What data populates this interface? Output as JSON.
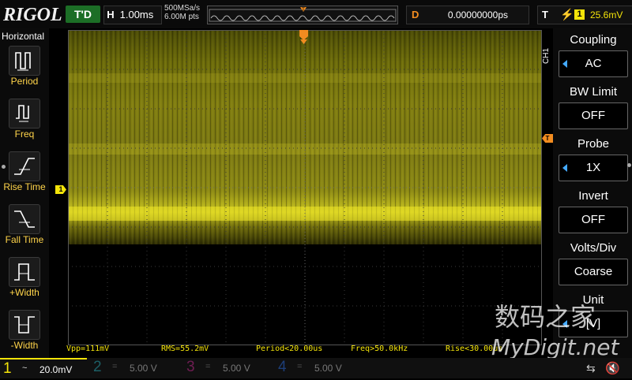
{
  "brand": "RIGOL",
  "header": {
    "trigger_status": "T'D",
    "timebase_label": "H",
    "timebase_value": "1.00ms",
    "sample_rate": "500MSa/s",
    "memory_depth": "6.00M pts",
    "delay_label": "D",
    "delay_value": "0.00000000ps",
    "trigger_label": "T",
    "trigger_source": "1",
    "trigger_level": "25.6mV",
    "trigger_edge_icon": "rising-edge-icon"
  },
  "left_menu": {
    "title": "Horizontal",
    "items": [
      {
        "label": "Period",
        "icon": "period-icon"
      },
      {
        "label": "Freq",
        "icon": "frequency-icon"
      },
      {
        "label": "Rise Time",
        "icon": "rise-time-icon"
      },
      {
        "label": "Fall Time",
        "icon": "fall-time-icon"
      },
      {
        "label": "+Width",
        "icon": "positive-width-icon"
      },
      {
        "label": "-Width",
        "icon": "negative-width-icon"
      }
    ]
  },
  "right_menu": {
    "channel_tag": "CH1",
    "items": [
      {
        "title": "Coupling",
        "value": "AC",
        "has_arrow": true
      },
      {
        "title": "BW Limit",
        "value": "OFF",
        "has_arrow": false
      },
      {
        "title": "Probe",
        "value": "1X",
        "has_arrow": true
      },
      {
        "title": "Invert",
        "value": "OFF",
        "has_arrow": false
      },
      {
        "title": "Volts/Div",
        "value": "Coarse",
        "has_arrow": false
      },
      {
        "title": "Unit",
        "value": "[V]",
        "has_arrow": true
      }
    ]
  },
  "measurements": {
    "vpp": "Vpp=111mV",
    "rms": "RMS=55.2mV",
    "period": "Period<20.00us",
    "freq": "Freq>50.0kHz",
    "rise": "Rise<30.00us"
  },
  "channels": [
    {
      "num": "1",
      "coupling": "~",
      "scale": "20.0mV",
      "color": "#f4e409",
      "active": true
    },
    {
      "num": "2",
      "coupling": "=",
      "scale": "5.00 V",
      "color": "#22c4d8",
      "active": false
    },
    {
      "num": "3",
      "coupling": "=",
      "scale": "5.00 V",
      "color": "#d6349b",
      "active": false
    },
    {
      "num": "4",
      "coupling": "=",
      "scale": "5.00 V",
      "color": "#2f6fe0",
      "active": false
    }
  ],
  "markers": {
    "channel_marker": "1",
    "trigger_marker": "T"
  },
  "watermark": {
    "line1": "数码之家",
    "line2": "MyDigit.net"
  },
  "colors": {
    "ch1": "#f4e409",
    "trigger_orange": "#f28c20",
    "status_green": "#1c6e26"
  }
}
